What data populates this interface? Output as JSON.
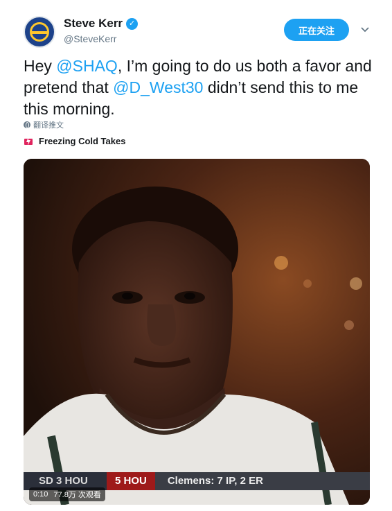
{
  "author": {
    "name": "Steve Kerr",
    "handle": "@SteveKerr",
    "verified": true
  },
  "actions": {
    "follow_label": "正在关注"
  },
  "tweet": {
    "part1": "Hey ",
    "mention1": "@SHAQ",
    "part2": ", I’m going to do us both a favor and pretend that ",
    "mention2": "@D_West30",
    "part3": " didn’t send this to me this morning."
  },
  "translate_label": "翻译推文",
  "moment_label": "Freezing Cold Takes",
  "media": {
    "duration": "0:10",
    "views": "77.8万 次观看",
    "ticker_left": "SD    3 HOU",
    "ticker_mid": "5 HOU",
    "ticker_right": "Clemens: 7 IP, 2 ER"
  },
  "colors": {
    "accent": "#1da1f2",
    "text": "#14171a",
    "muted": "#657786"
  }
}
